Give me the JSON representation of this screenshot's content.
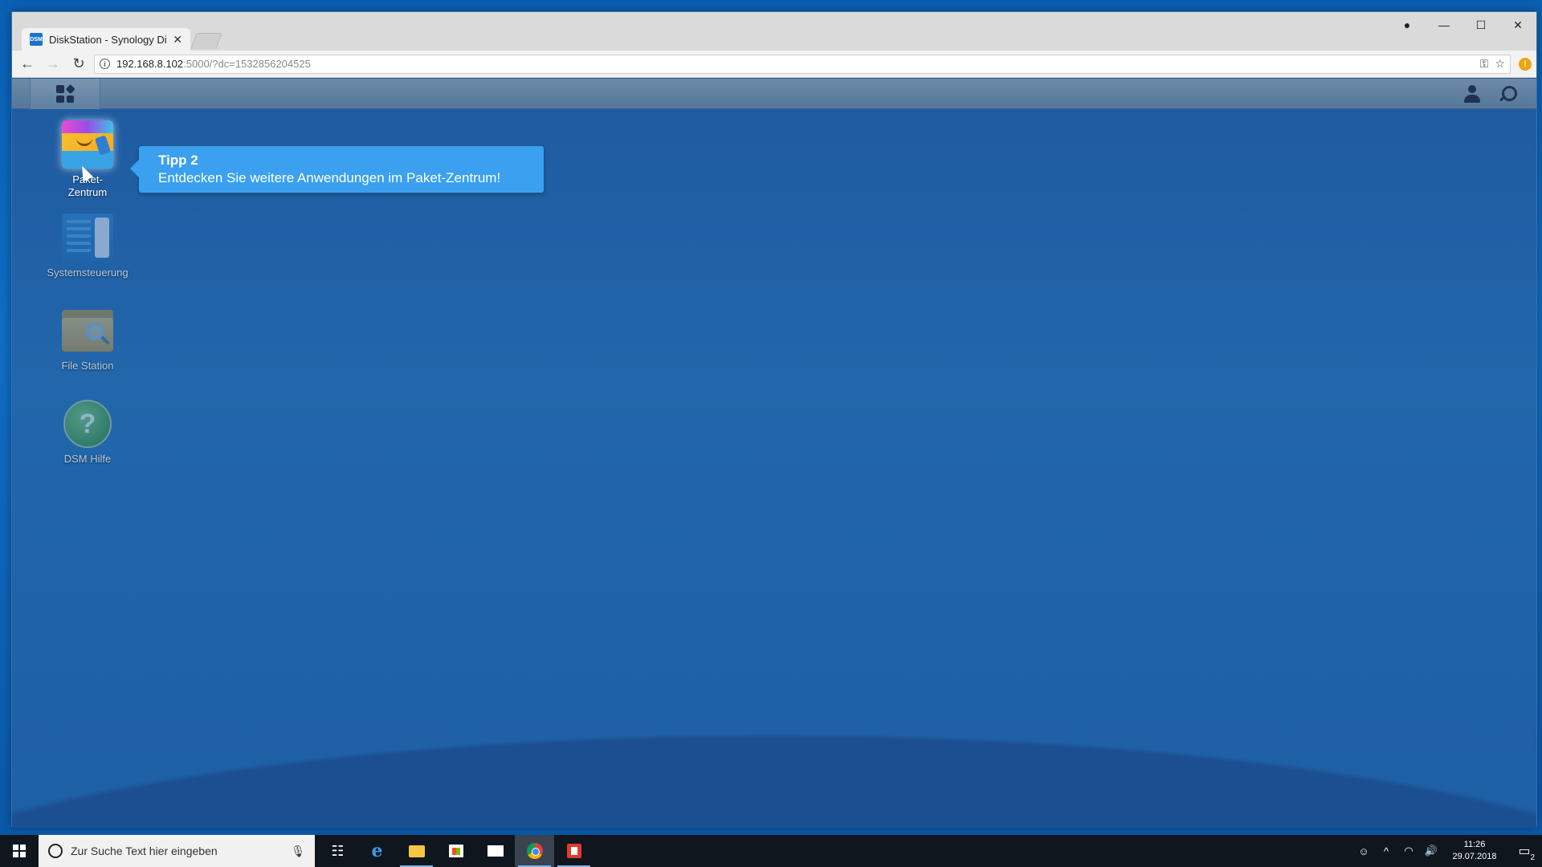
{
  "browser": {
    "tab_title": "DiskStation - Synology DiskStation",
    "tab_favicon_text": "DSM",
    "url_host": "192.168.8.102",
    "url_rest": ":5000/?dc=1532856204525"
  },
  "dsm": {
    "desktop_icons": [
      {
        "label": "Paket-\nZentrum"
      },
      {
        "label": "Systemsteuerung"
      },
      {
        "label": "File Station"
      },
      {
        "label": "DSM Hilfe"
      }
    ],
    "tip": {
      "title": "Tipp 2",
      "text": "Entdecken Sie weitere Anwendungen im Paket-Zentrum!"
    }
  },
  "windows": {
    "search_placeholder": "Zur Suche Text hier eingeben",
    "clock_time": "11:26",
    "clock_date": "29.07.2018",
    "notification_count": "2"
  },
  "colors": {
    "tip_background": "#3aa0ef",
    "dsm_background": "#1f5aa0",
    "taskbar": "#10161e"
  }
}
